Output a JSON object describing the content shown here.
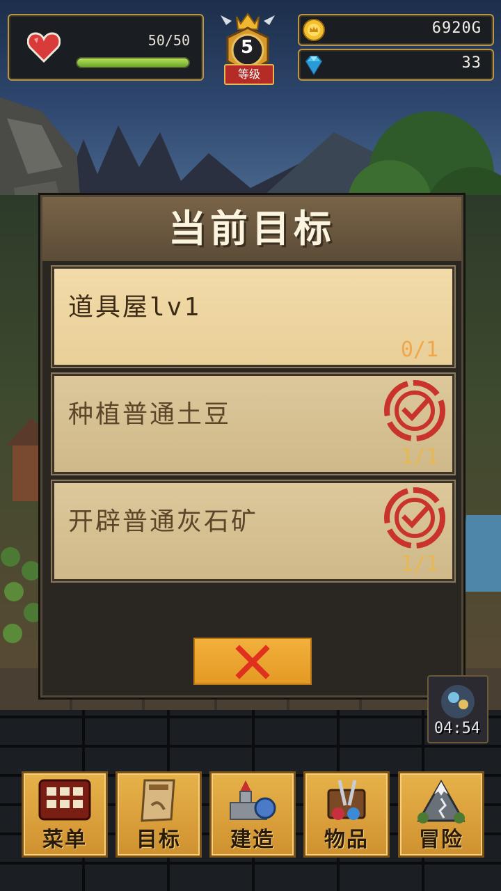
{
  "hud": {
    "hp_text": "50/50",
    "hp_fraction": 1.0,
    "level": "5",
    "level_label": "等级",
    "gold": "6920G",
    "gems": "33"
  },
  "dialog": {
    "title": "当前目标",
    "tasks": [
      {
        "name": "道具屋lv1",
        "progress": "0/1",
        "completed": false
      },
      {
        "name": "种植普通土豆",
        "progress": "1/1",
        "completed": true
      },
      {
        "name": "开辟普通灰石矿",
        "progress": "1/1",
        "completed": true
      }
    ],
    "close_icon": "close-x-icon"
  },
  "timer": "04:54",
  "nav": [
    {
      "label": "菜单",
      "icon": "menu-grid-icon"
    },
    {
      "label": "目标",
      "icon": "quest-scroll-icon"
    },
    {
      "label": "建造",
      "icon": "castle-icon"
    },
    {
      "label": "物品",
      "icon": "item-chest-icon"
    },
    {
      "label": "冒险",
      "icon": "mountain-icon"
    }
  ],
  "colors": {
    "accent_gold": "#e7b24a",
    "hp_green": "#8ccf3c",
    "stamp_red": "#c8342c",
    "progress_orange": "#f0a64a"
  }
}
